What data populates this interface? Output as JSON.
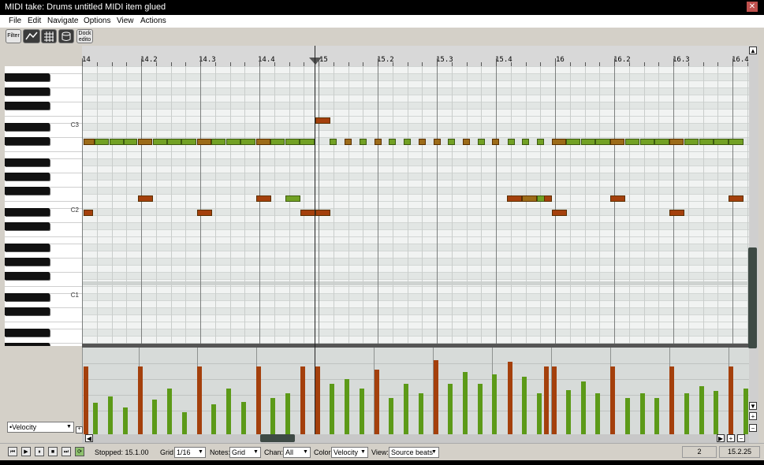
{
  "window": {
    "title": "MIDI take: Drums untitled MIDI item glued",
    "close_glyph": "✕"
  },
  "menu": [
    "File",
    "Edit",
    "Navigate",
    "Options",
    "View",
    "Actions"
  ],
  "toolbar": {
    "filter": "Filter",
    "dock_line1": "Dock",
    "dock_line2": "edito",
    "icons": [
      "envelope-icon",
      "grid-icon",
      "drum-icon"
    ]
  },
  "piano": {
    "labels": [
      "C3",
      "C2",
      "C1"
    ]
  },
  "ruler": {
    "labels": [
      "14",
      "14.2",
      "14.3",
      "14.4",
      "15",
      "15.2",
      "15.3",
      "15.4",
      "16",
      "16.2",
      "16.3",
      "16.4"
    ]
  },
  "lane": {
    "selected": "•Velocity",
    "add_glyph": "+"
  },
  "scroll": {
    "up": "▲",
    "down": "▼",
    "zoom_in": "+",
    "zoom_out": "−",
    "left": "◀",
    "right": "▶"
  },
  "transport": {
    "buttons": [
      "⏮",
      "▶",
      "⏸",
      "■",
      "⏭",
      "⟳"
    ],
    "status": "Stopped: 15.1.00"
  },
  "controls": {
    "grid_label": "Grid",
    "grid_value": "1/16",
    "notes_label": "Notes:",
    "notes_value": "Grid",
    "chan_label": "Chan:",
    "chan_value": "All",
    "color_label": "Color:",
    "color_value": "Velocity",
    "view_label": "View:",
    "view_value": "Source beats",
    "field1": "2",
    "field2": "15.2.25"
  },
  "colors": {
    "note_red": "#a4400c",
    "note_green": "#72a124",
    "note_olive": "#9c6b18"
  }
}
